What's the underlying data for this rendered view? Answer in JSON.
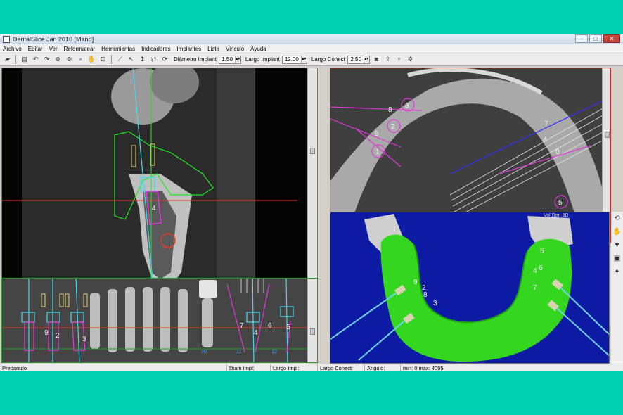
{
  "window": {
    "title": "DentalSlice Jan 2010 [Mand]",
    "controls": [
      "–",
      "□",
      "✕"
    ]
  },
  "menu": [
    "Archivo",
    "Editar",
    "Ver",
    "Reformatear",
    "Herramientas",
    "Indicadores",
    "Implantes",
    "Lista",
    "Vinculo",
    "Ayuda"
  ],
  "toolbar": {
    "diametro_label": "Diámetro Implant",
    "diametro_value": "1.50",
    "largo_implant_label": "Largo Implant",
    "largo_implant_value": "12.00",
    "largo_conect_label": "Largo Conect",
    "largo_conect_value": "2.50"
  },
  "panels": {
    "cross_section": {
      "implant_number": "4"
    },
    "axial": {
      "implant_numbers": [
        "3",
        "8",
        "2",
        "9",
        "1",
        "7",
        "4",
        "0",
        "5"
      ]
    },
    "panoramic": {
      "implant_numbers": [
        "9",
        "2",
        "3",
        "7",
        "4",
        "6",
        "5"
      ],
      "ruler_numbers": [
        "10",
        "11",
        "12"
      ]
    },
    "view3d": {
      "label": "Vol Ren 3D",
      "implant_numbers": [
        "5",
        "4",
        "6",
        "7",
        "9",
        "2",
        "8",
        "3"
      ]
    }
  },
  "status": {
    "state": "Preparado",
    "diam_label": "Diam Impl:",
    "largo_impl_label": "Largo Impl:",
    "largo_conect_label": "Largo Conect:",
    "angulo_label": "Angulo:",
    "minmax": "min: 0  max: 4095"
  },
  "colors": {
    "background": "#00d1b2",
    "implant_cyan": "#49d7e8",
    "implant_magenta": "#e03ad8",
    "guide_green": "#1fe81f",
    "nerve_red": "#e23b2b"
  }
}
